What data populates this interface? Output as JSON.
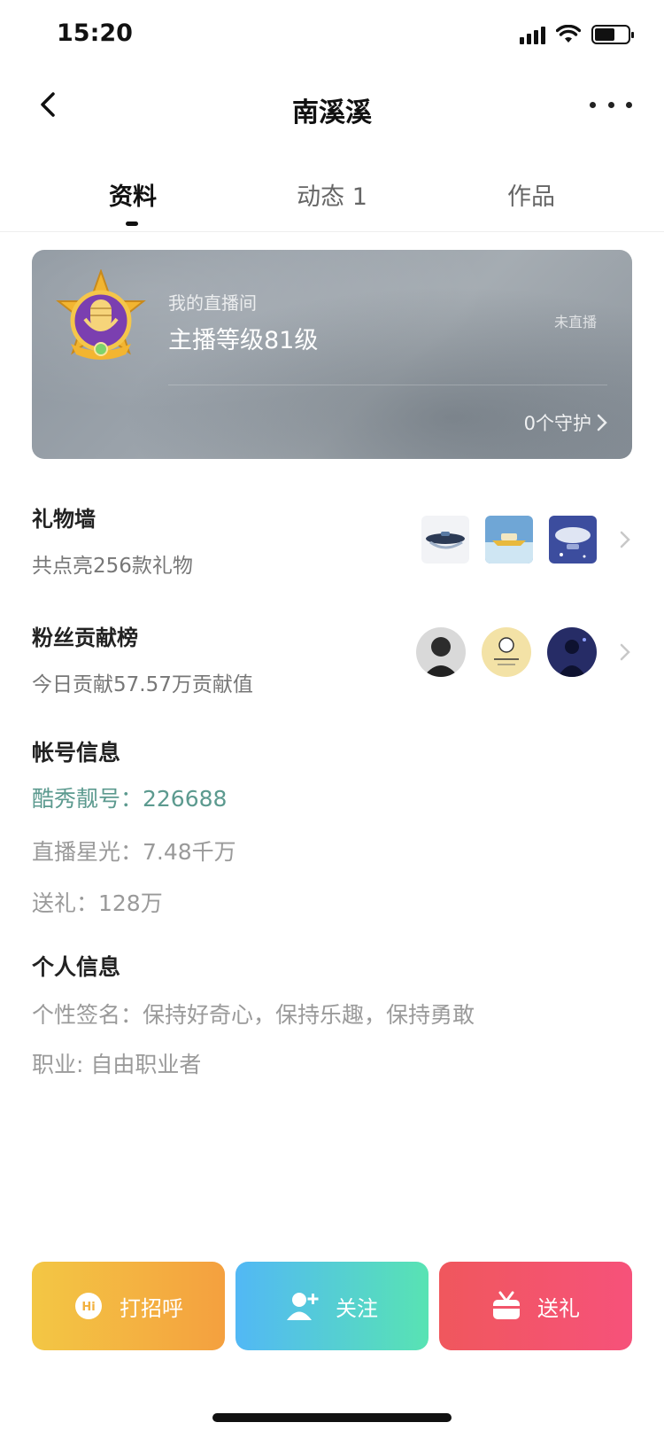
{
  "status_bar": {
    "time": "15:20"
  },
  "nav": {
    "title": "南溪溪"
  },
  "tabs": [
    {
      "label": "资料"
    },
    {
      "label": "动态 1"
    },
    {
      "label": "作品"
    }
  ],
  "live_card": {
    "subtitle": "我的直播间",
    "level": "主播等级81级",
    "status": "未直播",
    "guard": "0个守护"
  },
  "gift_wall": {
    "title": "礼物墙",
    "subtitle": "共点亮256款礼物"
  },
  "fans": {
    "title": "粉丝贡献榜",
    "subtitle": "今日贡献57.57万贡献值"
  },
  "account": {
    "title": "帐号信息",
    "id_line": "酷秀靓号：226688",
    "stars_line": "直播星光：7.48千万",
    "gift_line": "送礼：128万"
  },
  "personal": {
    "title": "个人信息",
    "signature_line": "个性签名：保持好奇心，保持乐趣，保持勇敢",
    "job_line": "职业: 自由职业者"
  },
  "actions": {
    "greet": "打招呼",
    "follow": "关注",
    "gift": "送礼"
  },
  "colors": {
    "greet_btn": "#F3B742",
    "follow_btn": "#55CCD5",
    "gift_btn": "#F2556A",
    "link_text": "#5C9A8F"
  },
  "icons": {
    "greet": "hi-bubble-icon",
    "follow": "add-user-icon",
    "gift": "gift-icon"
  }
}
